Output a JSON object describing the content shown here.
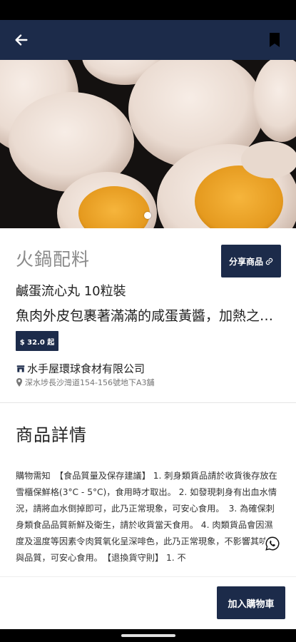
{
  "header": {
    "back_icon": "arrow-left-icon",
    "bookmark_icon": "bookmark-icon",
    "background": "#1c2b4a"
  },
  "hero": {
    "image": "fish-balls-with-salted-egg-yolk-filling",
    "page_indicator": {
      "current": 1,
      "total": 1
    }
  },
  "product": {
    "category": "火鍋配料",
    "share_label": "分享商品",
    "share_icon": "link-icon",
    "name": "鹹蛋流心丸 10粒裝",
    "description": "魚肉外皮包裹著滿滿的咸蛋黃醬，加熱之後流心效果極佳",
    "price": "$ 32.0 起",
    "shop_icon": "store-icon",
    "shop_name": "水手屋環球食材有限公司",
    "location_icon": "location-pin-icon",
    "address": "深水埗長沙灣道154-156號地下A3舖"
  },
  "details": {
    "title": "商品詳情",
    "notice": "購物需知　【食品質量及保存建議】 1. 刺身類貨品請於收貨後存放在雪櫃保鮮格(3°C - 5°C)，食用時才取出。 2. 如發現刺身有出血水情況，請將血水倒掉即可，此乃正常現象，可安心食用。　3. 為確保刺身類食品品質新鮮及衛生，請於收貨當天食用。 4. 肉類貨品會因濕度及溫度等因素令肉質氧化呈深啡色，此乃正常現象，不影響其味道與品質，可安心食用。　【退換貨守則】 1. 不"
  },
  "floating": {
    "whatsapp_icon": "whatsapp-icon"
  },
  "footer": {
    "add_to_cart_label": "加入購物車"
  },
  "colors": {
    "brand": "#1c2b4a",
    "muted_text": "#8a8a8a"
  }
}
